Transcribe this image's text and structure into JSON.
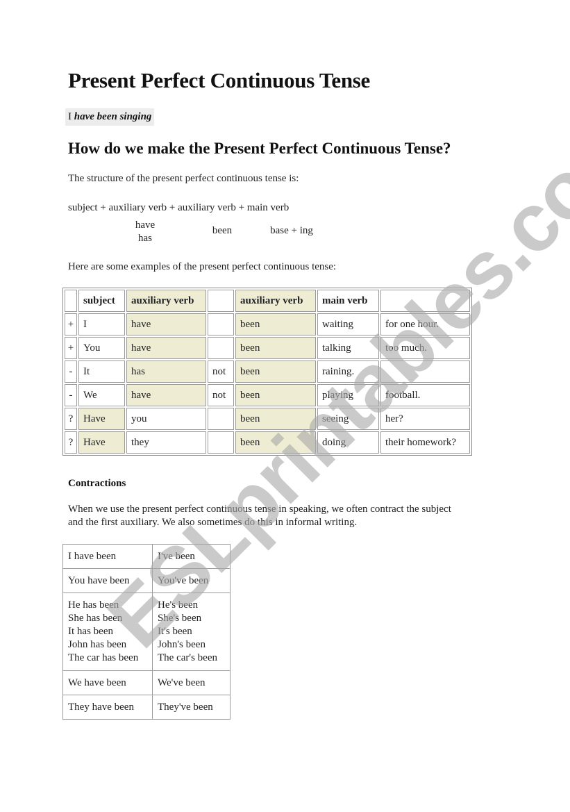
{
  "title": "Present Perfect Continuous Tense",
  "example": {
    "subject": "I",
    "verb": "have been singing"
  },
  "subtitle": "How do we make the Present Perfect Continuous Tense?",
  "structure_intro": "The structure of the present perfect continuous tense is:",
  "structure": {
    "formula": "subject + auxiliary verb + auxiliary verb + main verb",
    "aux1": [
      "have",
      "has"
    ],
    "aux2": "been",
    "main": "base + ing"
  },
  "examples_intro": "Here are some examples of the present perfect continuous tense:",
  "examples_table": {
    "headers": [
      "",
      "subject",
      "auxiliary verb",
      "",
      "auxiliary verb",
      "main verb",
      ""
    ],
    "rows": [
      [
        "+",
        "I",
        "have",
        "",
        "been",
        "waiting",
        "for one hour."
      ],
      [
        "+",
        "You",
        "have",
        "",
        "been",
        "talking",
        "too much."
      ],
      [
        "-",
        "It",
        "has",
        "not",
        "been",
        "raining.",
        ""
      ],
      [
        "-",
        "We",
        "have",
        "not",
        "been",
        "playing",
        "football."
      ],
      [
        "?",
        "Have",
        "you",
        "",
        "been",
        "seeing",
        "her?"
      ],
      [
        "?",
        "Have",
        "they",
        "",
        "been",
        "doing",
        "their homework?"
      ]
    ],
    "highlight_color": "#eeecd2"
  },
  "contractions": {
    "heading": "Contractions",
    "intro_line1": "When we use the present perfect continuous tense in speaking, we often contract the subject",
    "intro_line2": "and the first auxiliary. We also sometimes do this in informal writing.",
    "rows": [
      {
        "full": [
          "I have been"
        ],
        "short": [
          "I've been"
        ]
      },
      {
        "full": [
          "You have been"
        ],
        "short": [
          "You've been"
        ]
      },
      {
        "full": [
          "He has been",
          "She has been",
          "It has been",
          "John has been",
          "The car has been"
        ],
        "short": [
          "He's been",
          "She's been",
          "It's been",
          "John's been",
          "The car's been"
        ]
      },
      {
        "full": [
          "We have been"
        ],
        "short": [
          "We've been"
        ]
      },
      {
        "full": [
          "They have been"
        ],
        "short": [
          "They've been"
        ]
      }
    ]
  },
  "watermark": "ESLprintables.com"
}
